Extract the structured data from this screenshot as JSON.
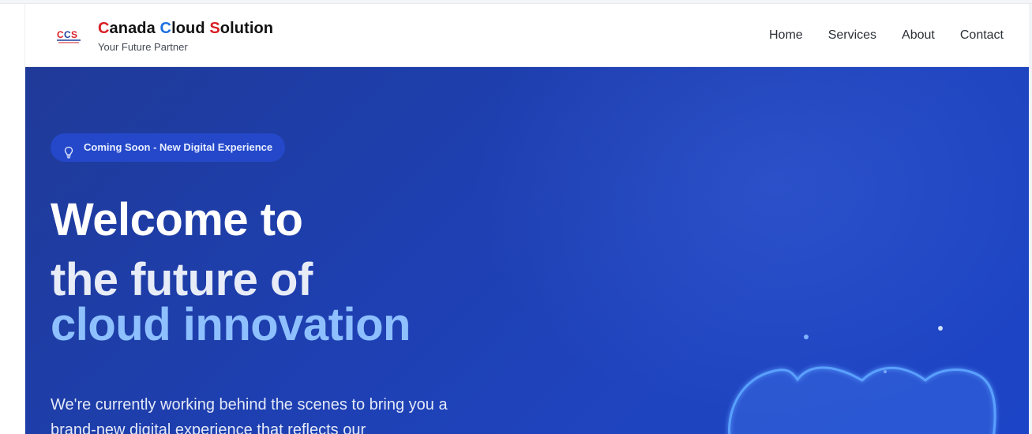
{
  "brand": {
    "letters": [
      "C",
      "C",
      "S"
    ],
    "name_parts": [
      "anada ",
      "loud ",
      "olution"
    ],
    "tagline": "Your Future Partner",
    "logo_icon": "ccs-logo-icon"
  },
  "nav": {
    "items": [
      "Home",
      "Services",
      "About",
      "Contact"
    ]
  },
  "hero": {
    "badge_icon": "lightbulb-icon",
    "badge_text": "Coming Soon - New Digital Experience",
    "headline_line1": "Welcome to",
    "headline_line2": "the future of",
    "headline_line3": "cloud innovation",
    "subtext": "We're currently working behind the scenes to bring you a brand-new digital experience that reflects our",
    "illustration": "cloud-icon"
  },
  "colors": {
    "brand_red": "#d81f26",
    "brand_blue": "#1e6fe0",
    "hero_bg": "#1e3fb0",
    "accent_light_blue": "#8ec0ff"
  }
}
